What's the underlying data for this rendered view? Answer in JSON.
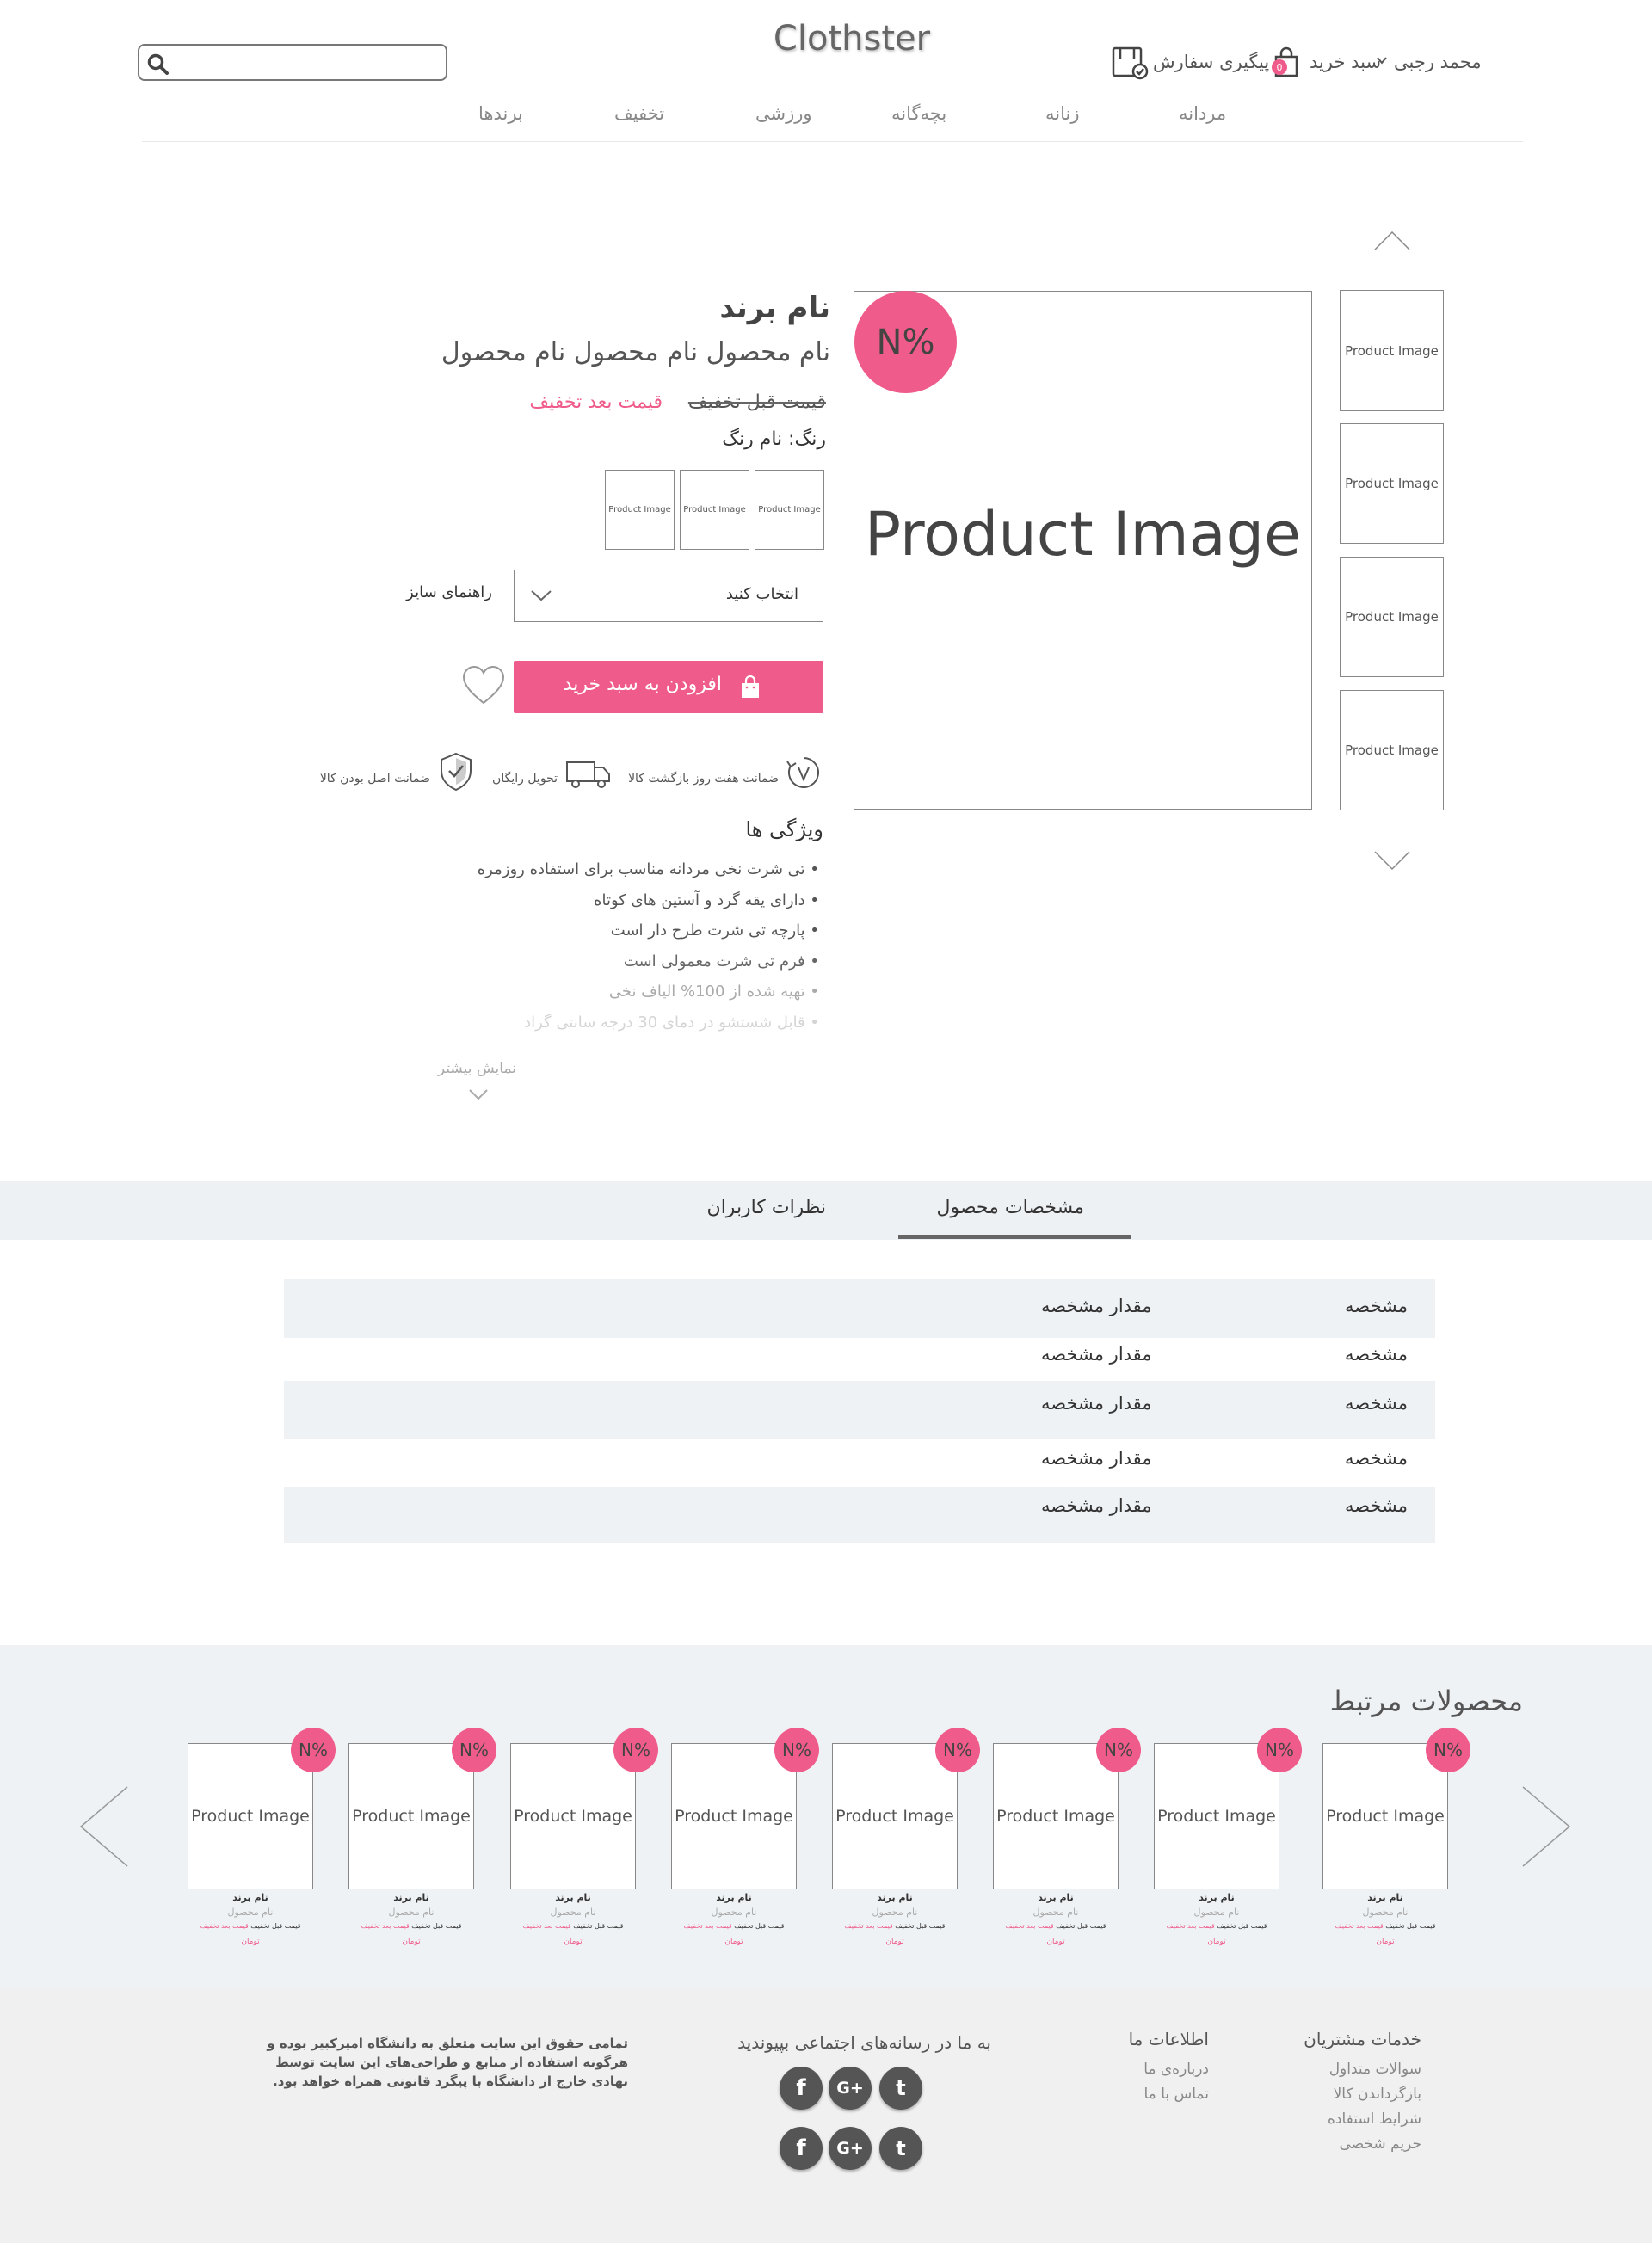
{
  "header": {
    "logo": "Clothster",
    "user_name": "محمد رجبی",
    "cart_label": "سبد خرید",
    "cart_count": "0",
    "order_tracking_label": "پیگیری سفارش",
    "search_placeholder": ""
  },
  "nav": {
    "items": [
      {
        "label": "مردانه"
      },
      {
        "label": "زنانه"
      },
      {
        "label": "بچه‌گانه"
      },
      {
        "label": "ورزشی"
      },
      {
        "label": "تخفیف"
      },
      {
        "label": "برندها"
      }
    ]
  },
  "gallery": {
    "thumbnails": [
      "Product Image",
      "Product Image",
      "Product Image",
      "Product Image"
    ],
    "main_image_label": "Product Image",
    "discount_badge": "N%"
  },
  "product": {
    "brand": "نام برند",
    "name": "نام محصول نام محصول نام محصول",
    "price_before": "قیمت قبل تخفیف",
    "price_after": "قیمت بعد تخفیف",
    "color_label": "رنگ: نام رنگ",
    "color_swatches": [
      "Product Image",
      "Product Image",
      "Product Image"
    ],
    "size_select_value": "انتخاب کنید",
    "size_guide": "راهنمای سایز",
    "add_to_cart": "افزودن به سبد خرید",
    "accent_color": "#ef5b8a"
  },
  "guarantees": [
    {
      "label": "ضمانت هفت روز بازگشت کالا",
      "icon": "return-7-days-icon"
    },
    {
      "label": "تحویل رایگان",
      "icon": "delivery-truck-icon"
    },
    {
      "label": "ضمانت اصل بودن کالا",
      "icon": "shield-check-icon"
    }
  ],
  "features": {
    "title": "ویژگی ها",
    "items": [
      "تی شرت نخی مردانه مناسب برای استفاده روزمره",
      "دارای یقه گرد و آستین های کوتاه",
      "پارچه تی شرت طرح دار است",
      "فرم تی شرت معمولی است",
      "تهیه شده از 100% الیاف نخی",
      "قابل شستشو در دمای 30 درجه سانتی گراد"
    ],
    "show_more": "نمایش بیشتر"
  },
  "tabs": {
    "specs": "مشخصات محصول",
    "reviews": "نظرات کاربران",
    "active": "specs"
  },
  "specs": [
    {
      "key": "مشخصه",
      "value": "مقدار مشخصه"
    },
    {
      "key": "مشخصه",
      "value": "مقدار مشخصه"
    },
    {
      "key": "مشخصه",
      "value": "مقدار مشخصه"
    },
    {
      "key": "مشخصه",
      "value": "مقدار مشخصه"
    },
    {
      "key": "مشخصه",
      "value": "مقدار مشخصه"
    }
  ],
  "related": {
    "title": "محصولات مرتبط",
    "cards": [
      {
        "image": "Product Image",
        "badge": "N%",
        "brand": "نام برند",
        "name": "نام محصول",
        "price_before": "قیمت قبل تخفیف",
        "price_after": "قیمت بعد تخفیف",
        "currency": "تومان"
      },
      {
        "image": "Product Image",
        "badge": "N%",
        "brand": "نام برند",
        "name": "نام محصول",
        "price_before": "قیمت قبل تخفیف",
        "price_after": "قیمت بعد تخفیف",
        "currency": "تومان"
      },
      {
        "image": "Product Image",
        "badge": "N%",
        "brand": "نام برند",
        "name": "نام محصول",
        "price_before": "قیمت قبل تخفیف",
        "price_after": "قیمت بعد تخفیف",
        "currency": "تومان"
      },
      {
        "image": "Product Image",
        "badge": "N%",
        "brand": "نام برند",
        "name": "نام محصول",
        "price_before": "قیمت قبل تخفیف",
        "price_after": "قیمت بعد تخفیف",
        "currency": "تومان"
      },
      {
        "image": "Product Image",
        "badge": "N%",
        "brand": "نام برند",
        "name": "نام محصول",
        "price_before": "قیمت قبل تخفیف",
        "price_after": "قیمت بعد تخفیف",
        "currency": "تومان"
      },
      {
        "image": "Product Image",
        "badge": "N%",
        "brand": "نام برند",
        "name": "نام محصول",
        "price_before": "قیمت قبل تخفیف",
        "price_after": "قیمت بعد تخفیف",
        "currency": "تومان"
      },
      {
        "image": "Product Image",
        "badge": "N%",
        "brand": "نام برند",
        "name": "نام محصول",
        "price_before": "قیمت قبل تخفیف",
        "price_after": "قیمت بعد تخفیف",
        "currency": "تومان"
      },
      {
        "image": "Product Image",
        "badge": "N%",
        "brand": "نام برند",
        "name": "نام محصول",
        "price_before": "قیمت قبل تخفیف",
        "price_after": "قیمت بعد تخفیف",
        "currency": "تومان"
      }
    ]
  },
  "footer": {
    "customer_service": {
      "title": "خدمات مشتریان",
      "links": [
        "سوالات متداول",
        "بازگرداندن کالا",
        "شرایط استفاده",
        "حریم شخصی"
      ]
    },
    "about": {
      "title": "اطلاعات ما",
      "links": [
        "درباره‌ی ما",
        "تماس با ما"
      ]
    },
    "social_title": "به ما در رسانه‌های اجتماعی بپیوندید",
    "social_icons": [
      "facebook-icon",
      "google-plus-icon",
      "twitter-icon"
    ],
    "social_glyphs": {
      "facebook": "f",
      "google": "G+",
      "twitter": "t"
    },
    "copyright": "تمامی حقوق این سایت متعلق به دانشگاه امیرکبیر بوده و هرگونه استفاده از منابع و طراحی‌های این سایت توسط نهادی خارج از دانشگاه با پیگرد قانونی همراه خواهد بود."
  }
}
